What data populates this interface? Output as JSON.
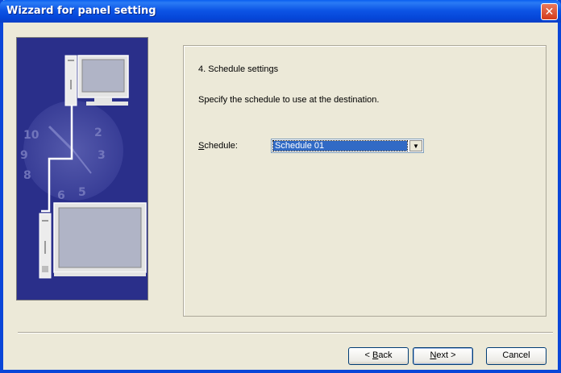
{
  "window": {
    "title": "Wizzard for panel setting",
    "close_glyph": "✕"
  },
  "content": {
    "step_title": "4. Schedule settings",
    "description": "Specify the schedule to use at the destination.",
    "schedule_label_mnemonic": "S",
    "schedule_label_rest": "chedule:",
    "schedule_value": "Schedule 01",
    "dropdown_glyph": "▼"
  },
  "buttons": {
    "back_prefix": "< ",
    "back_mnemonic": "B",
    "back_rest": "ack",
    "next_mnemonic": "N",
    "next_rest": "ext >",
    "cancel": "Cancel"
  },
  "colors": {
    "titlebar": "#0a46d8",
    "dialog_bg": "#ece9d8",
    "selection": "#316ac5",
    "illustration_bg": "#2a2f8a"
  }
}
